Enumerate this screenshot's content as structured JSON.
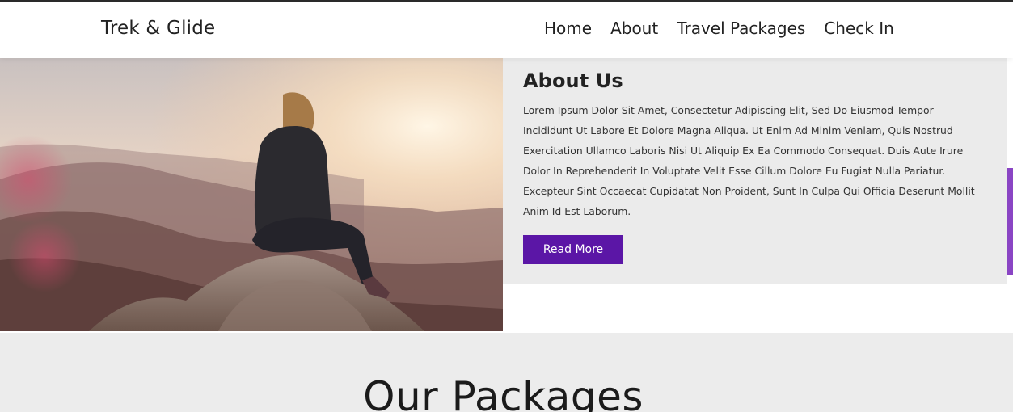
{
  "header": {
    "brand": "Trek & Glide",
    "nav": [
      "Home",
      "About",
      "Travel Packages",
      "Check In"
    ]
  },
  "about": {
    "title": "About Us",
    "body": "Lorem Ipsum Dolor Sit Amet, Consectetur Adipiscing Elit, Sed Do Eiusmod Tempor Incididunt Ut Labore Et Dolore Magna Aliqua. Ut Enim Ad Minim Veniam, Quis Nostrud Exercitation Ullamco Laboris Nisi Ut Aliquip Ex Ea Commodo Consequat. Duis Aute Irure Dolor In Reprehenderit In Voluptate Velit Esse Cillum Dolore Eu Fugiat Nulla Pariatur. Excepteur Sint Occaecat Cupidatat Non Proident, Sunt In Culpa Qui Officia Deserunt Mollit Anim Id Est Laborum.",
    "button": "Read More"
  },
  "packages": {
    "title": "Our Packages"
  },
  "colors": {
    "accent": "#5b16a6",
    "side_accent": "#8a45c4",
    "card_bg": "#ebebeb"
  }
}
